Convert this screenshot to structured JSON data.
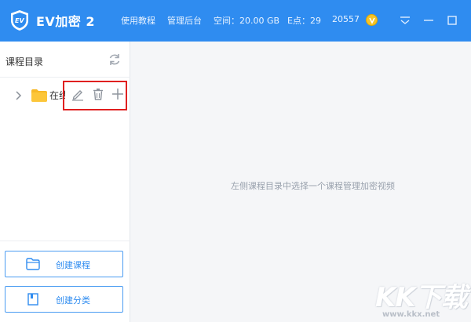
{
  "app": {
    "title": "EV加密 2",
    "logo_icon": "ev-shield-logo-icon"
  },
  "header": {
    "tutorial": "使用教程",
    "admin": "管理后台",
    "space": "空间：20.00 GB",
    "e_points": "E点：29",
    "coins": "20557",
    "coin_icon": "coin-icon"
  },
  "window_controls": [
    "dropdown-icon",
    "minimize-icon",
    "maximize-icon"
  ],
  "sidebar": {
    "title": "课程目录",
    "tree": [
      {
        "label": "在线",
        "icon": "folder-icon",
        "actions": [
          "edit-icon",
          "delete-icon",
          "add-icon"
        ]
      }
    ],
    "buttons": {
      "create_course": "创建课程",
      "create_category": "创建分类"
    }
  },
  "main": {
    "hint": "左侧课程目录中选择一个课程管理加密视频"
  },
  "watermark": {
    "text": "KK下载",
    "url": "www.kkx.net"
  },
  "colors": {
    "accent": "#2f8cf0",
    "highlight_border": "#e02020",
    "coin": "#f6c427"
  }
}
